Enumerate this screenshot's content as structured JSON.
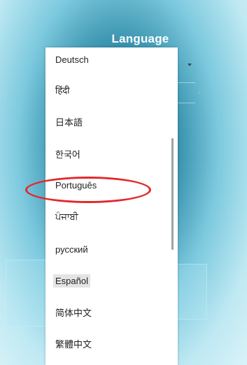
{
  "screen": {
    "title": "Language"
  },
  "language_list": {
    "selected": "Español",
    "items": [
      {
        "label": "Deutsch"
      },
      {
        "label": "हिंदी"
      },
      {
        "label": "日本語"
      },
      {
        "label": "한국어"
      },
      {
        "label": "Português"
      },
      {
        "label": "ਪੰਜਾਬੀ"
      },
      {
        "label": "русский"
      },
      {
        "label": "Español"
      },
      {
        "label": "简体中文"
      },
      {
        "label": "繁體中文"
      }
    ]
  },
  "annotation": {
    "color": "#e3282b",
    "target": "Português"
  }
}
